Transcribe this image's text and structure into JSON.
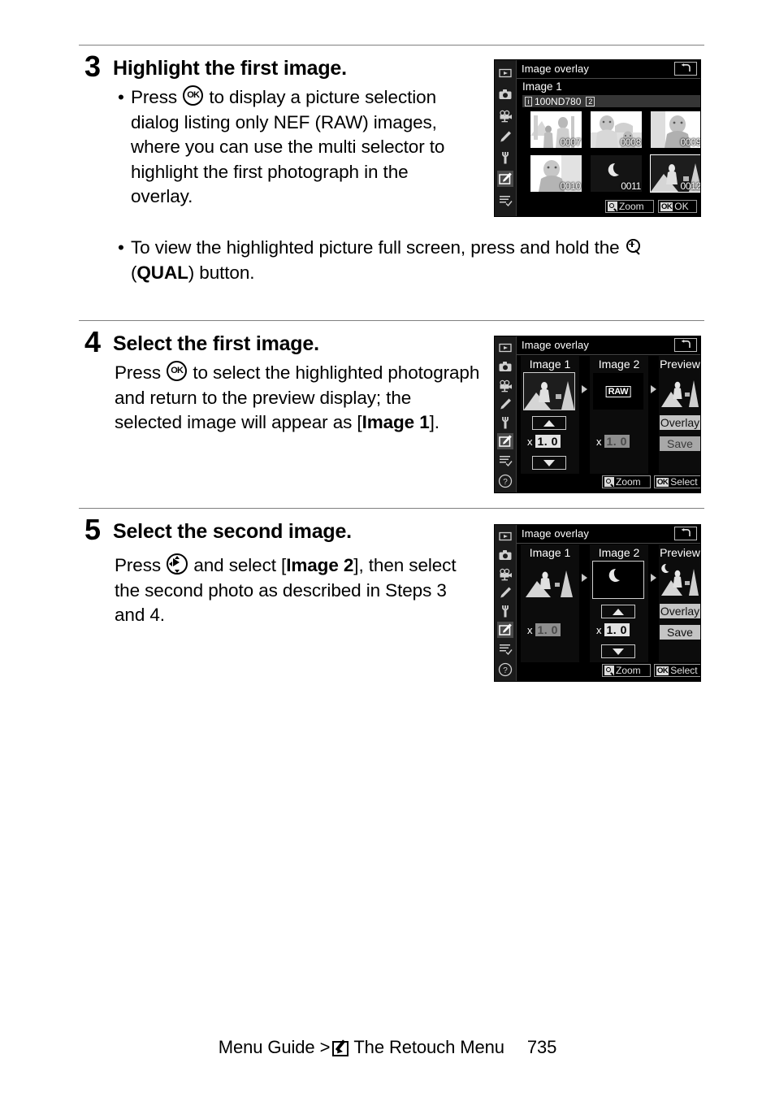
{
  "page": {
    "number": "735",
    "footer_prefix": "Menu Guide >",
    "footer_section": "The Retouch Menu",
    "footer_icon": "retouch-menu-icon"
  },
  "steps": [
    {
      "number": "3",
      "title": "Highlight the first image.",
      "bullets": [
        {
          "parts": [
            {
              "t": "Press "
            },
            {
              "icon": "ok-button-icon"
            },
            {
              "t": " to display a picture selection dialog listing only NEF (RAW) images, where you can use the multi selector to highlight the first photograph in the overlay."
            }
          ]
        },
        {
          "parts": [
            {
              "t": "To view the highlighted picture full screen, press and hold the "
            },
            {
              "icon": "qual-zoom-button-icon"
            },
            {
              "t": " ("
            },
            {
              "b": "QUAL"
            },
            {
              "t": ") button."
            }
          ]
        }
      ]
    },
    {
      "number": "4",
      "title": "Select the first image.",
      "paragraph": [
        {
          "t": "Press "
        },
        {
          "icon": "ok-button-icon"
        },
        {
          "t": " to select the highlighted photograph and return to the preview display; the selected image will appear as ["
        },
        {
          "b": "Image 1"
        },
        {
          "t": "]."
        }
      ]
    },
    {
      "number": "5",
      "title": "Select the second image.",
      "paragraph": [
        {
          "t": "Press "
        },
        {
          "icon": "multi-selector-right-icon"
        },
        {
          "t": " and select ["
        },
        {
          "b": "Image 2"
        },
        {
          "t": "], then select the second photo as described in Steps 3 and 4."
        }
      ]
    }
  ],
  "screens": [
    {
      "id": "picture-selection",
      "title": "Image overlay",
      "back_icon": "back-arrow-icon",
      "sidebar_icons": [
        "playback-icon",
        "photo-shooting-icon",
        "movie-shooting-icon",
        "custom-settings-icon",
        "setup-icon",
        "retouch-icon",
        "my-menu-icon"
      ],
      "active_sidebar": "retouch-icon",
      "sub_label": "Image 1",
      "folder_info_icon": "i",
      "folder_name": "100ND780",
      "card_slot": "2",
      "thumbnails": [
        {
          "number": "0007",
          "selected": false,
          "scene": "family"
        },
        {
          "number": "0008",
          "selected": false,
          "scene": "portrait-group"
        },
        {
          "number": "0009",
          "selected": false,
          "scene": "portrait"
        },
        {
          "number": "0010",
          "selected": false,
          "scene": "portrait"
        },
        {
          "number": "0011",
          "selected": false,
          "scene": "moon"
        },
        {
          "number": "0012",
          "selected": true,
          "scene": "person-landscape"
        }
      ],
      "bottom_buttons": [
        {
          "badge": "zoom-icon",
          "label": "Zoom"
        },
        {
          "badge": "OK",
          "label": "OK"
        }
      ]
    },
    {
      "id": "overlay-image1-selected",
      "title": "Image overlay",
      "back_icon": "back-arrow-icon",
      "sidebar_icons": [
        "playback-icon",
        "photo-shooting-icon",
        "movie-shooting-icon",
        "custom-settings-icon",
        "setup-icon",
        "retouch-icon",
        "my-menu-icon",
        "help-icon"
      ],
      "active_sidebar": "retouch-icon",
      "columns": [
        {
          "title": "Image 1",
          "thumb": "person-landscape",
          "selected": true,
          "gain": "1. 0",
          "gain_active": true,
          "steppers": true
        },
        {
          "title": "Image 2",
          "thumb": "raw-placeholder",
          "raw_label": "RAW",
          "selected": false,
          "gain": "1. 0",
          "gain_active": false,
          "steppers": false
        },
        {
          "title": "Preview",
          "thumb": "person-landscape",
          "buttons": [
            {
              "label": "Overlay",
              "active": true
            },
            {
              "label": "Save",
              "active": false
            }
          ]
        }
      ],
      "bottom_buttons": [
        {
          "badge": "zoom-icon",
          "label": "Zoom"
        },
        {
          "badge": "OK",
          "label": "Select"
        }
      ]
    },
    {
      "id": "overlay-image2-selected",
      "title": "Image overlay",
      "back_icon": "back-arrow-icon",
      "sidebar_icons": [
        "playback-icon",
        "photo-shooting-icon",
        "movie-shooting-icon",
        "custom-settings-icon",
        "setup-icon",
        "retouch-icon",
        "my-menu-icon",
        "help-icon"
      ],
      "active_sidebar": "retouch-icon",
      "columns": [
        {
          "title": "Image 1",
          "thumb": "person-landscape",
          "selected": false,
          "gain": "1. 0",
          "gain_active": false,
          "steppers": false
        },
        {
          "title": "Image 2",
          "thumb": "moon",
          "selected": true,
          "gain": "1. 0",
          "gain_active": true,
          "steppers": true
        },
        {
          "title": "Preview",
          "thumb": "moon-over-landscape",
          "buttons": [
            {
              "label": "Overlay",
              "active": true
            },
            {
              "label": "Save",
              "active": true
            }
          ]
        }
      ],
      "bottom_buttons": [
        {
          "badge": "zoom-icon",
          "label": "Zoom"
        },
        {
          "badge": "OK",
          "label": "Select"
        }
      ]
    }
  ]
}
